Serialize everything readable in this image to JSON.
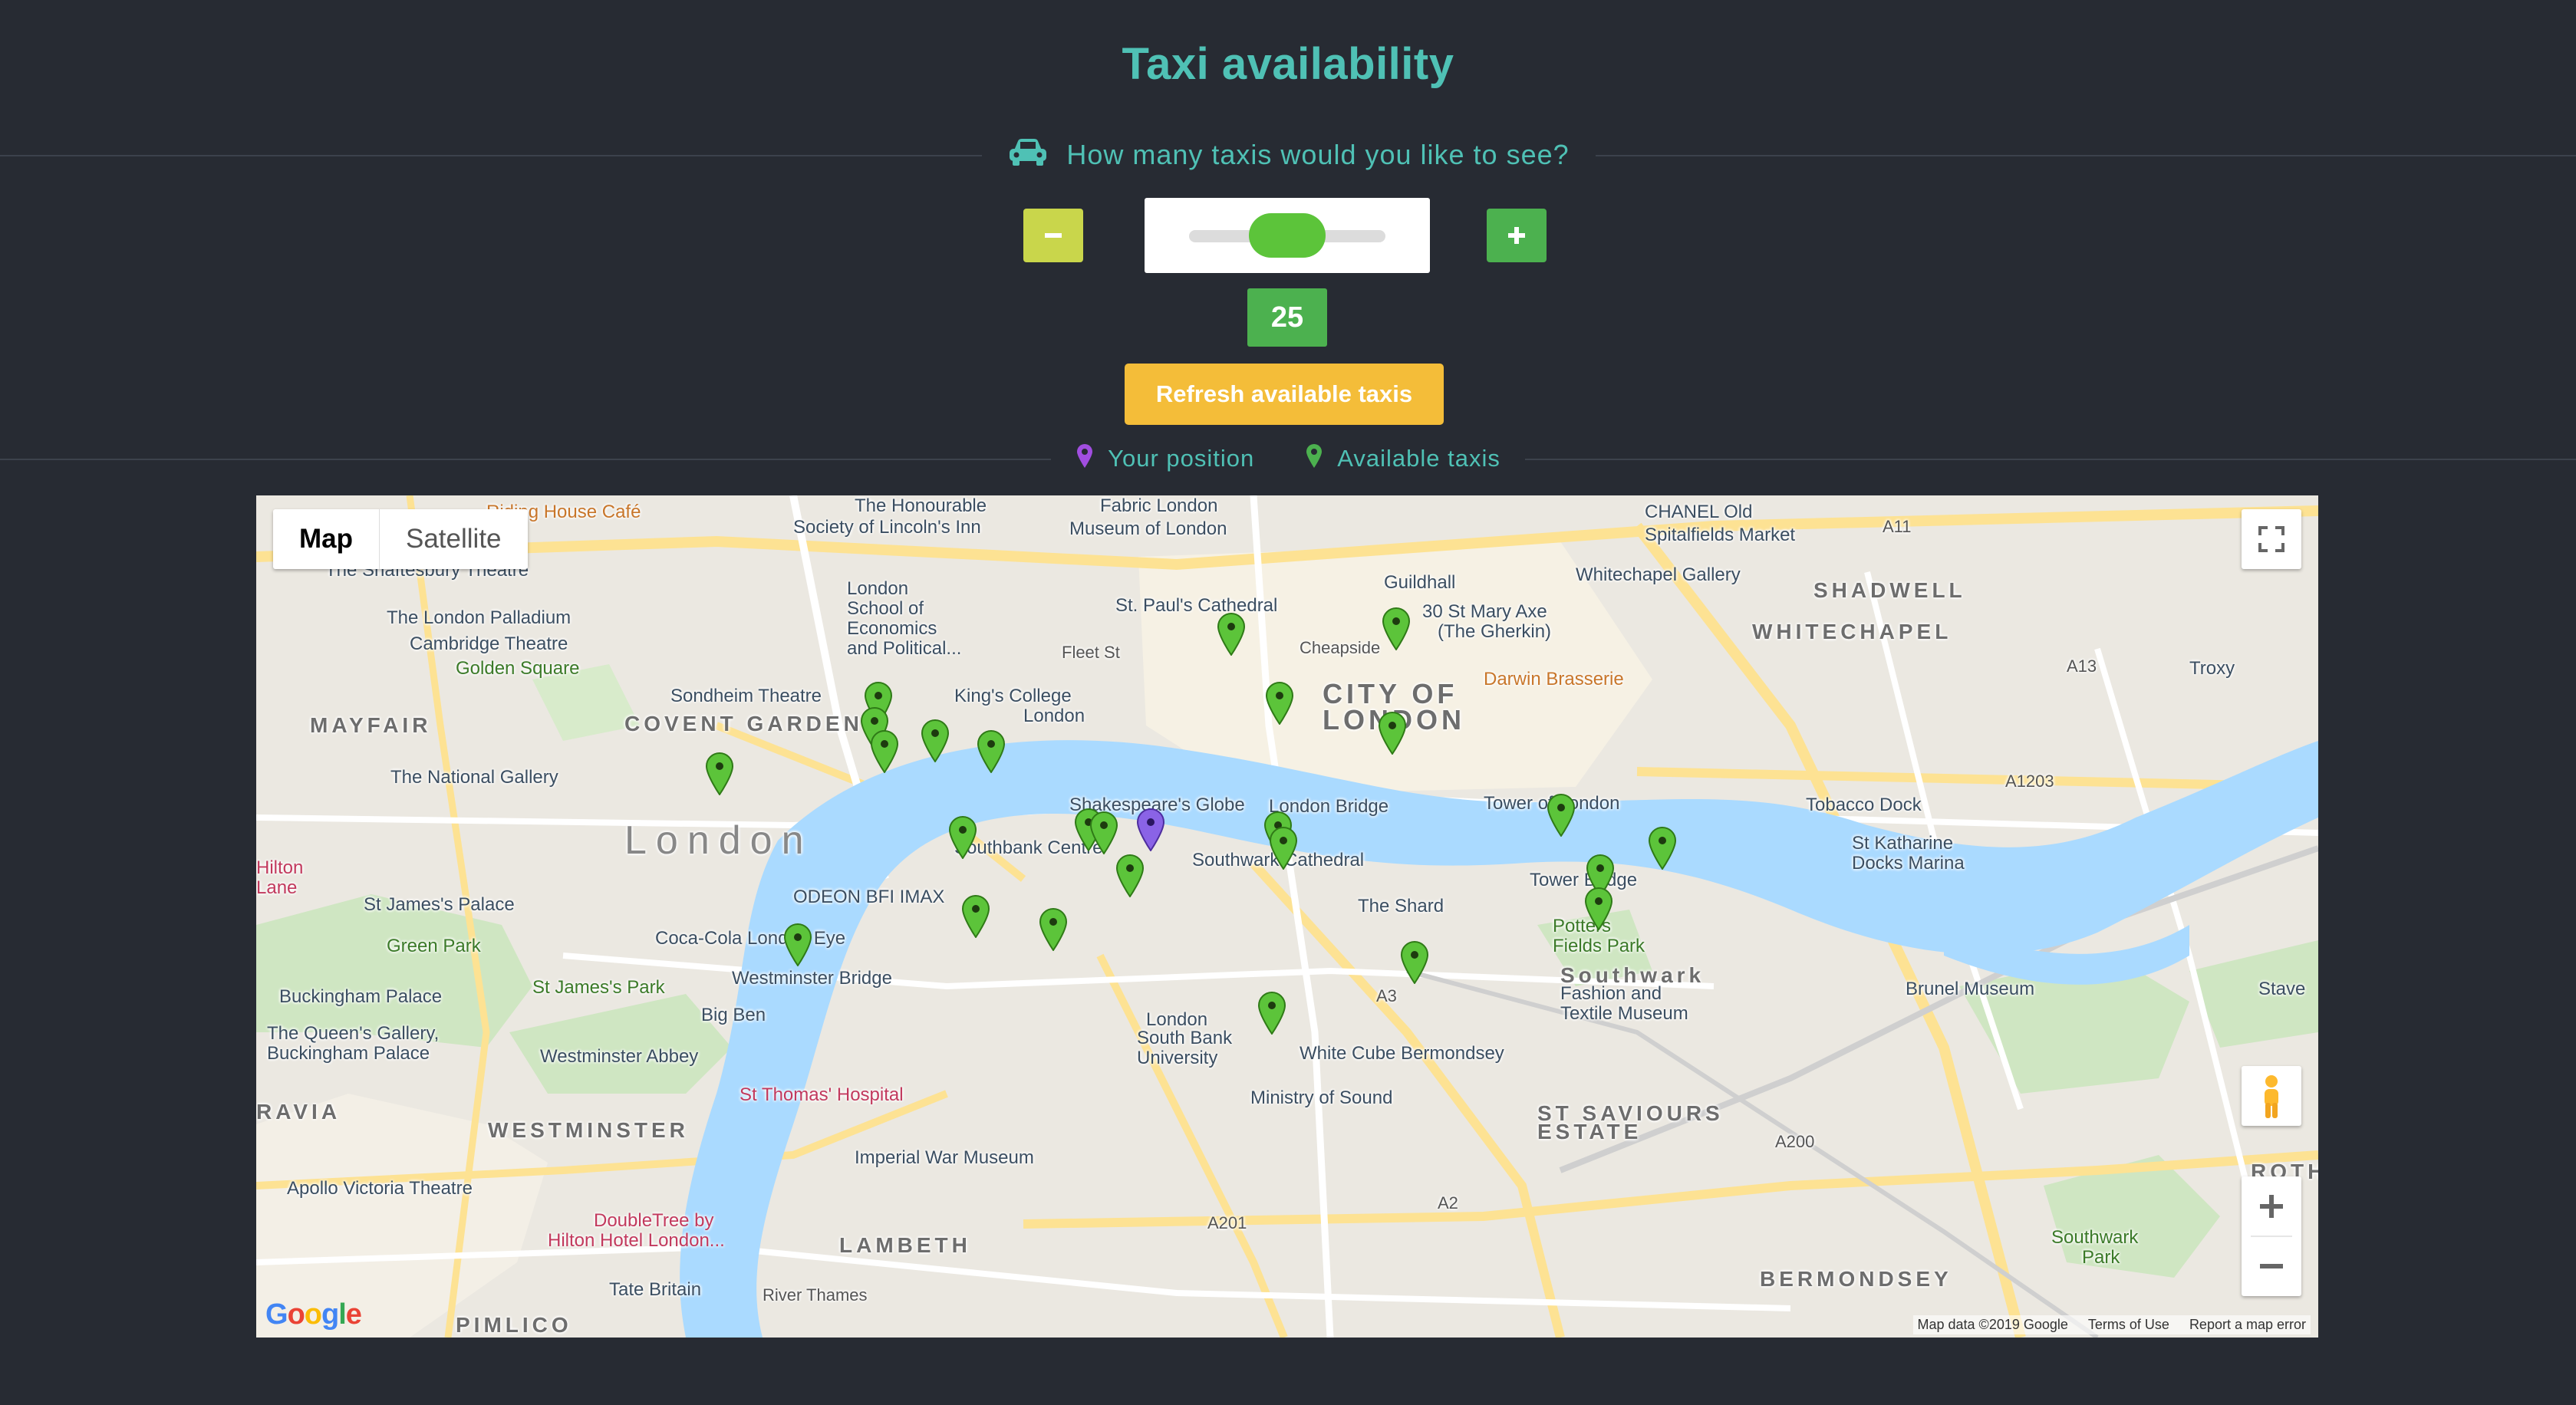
{
  "page": {
    "title": "Taxi availability",
    "question": "How many taxis would you like to see?",
    "minus_label": "−",
    "plus_label": "+",
    "taxi_count": "25",
    "slider_value": 25,
    "refresh_label": "Refresh available taxis",
    "legend_your_position": "Your position",
    "legend_available_taxis": "Available taxis"
  },
  "colors": {
    "accent": "#4fc1b5",
    "background": "#272b33",
    "minus_button": "#c9d64b",
    "plus_button": "#4cb14f",
    "refresh_button": "#f4bd39",
    "taxi_pin": "#5cc43a",
    "position_pin": "#8a63e6"
  },
  "map": {
    "type_tabs": [
      "Map",
      "Satellite"
    ],
    "active_tab": "Map",
    "attribution": [
      "Map data ©2019 Google",
      "Terms of Use",
      "Report a map error"
    ],
    "google_logo": "Google",
    "labels": [
      {
        "text": "Riding House Café",
        "cls": "place food"
      },
      {
        "text": "The Honourable",
        "cls": "place"
      },
      {
        "text": "Society of Lincoln's Inn",
        "cls": "place"
      },
      {
        "text": "Fabric London",
        "cls": "place"
      },
      {
        "text": "Museum of London",
        "cls": "place"
      },
      {
        "text": "CHANEL Old",
        "cls": "place"
      },
      {
        "text": "Spitalfields Market",
        "cls": "place"
      },
      {
        "text": "The Shaftesbury Theatre",
        "cls": "place"
      },
      {
        "text": "London",
        "cls": "place"
      },
      {
        "text": "School of",
        "cls": "place"
      },
      {
        "text": "Economics",
        "cls": "place"
      },
      {
        "text": "and Political...",
        "cls": "place"
      },
      {
        "text": "Guildhall",
        "cls": "place"
      },
      {
        "text": "Whitechapel Gallery",
        "cls": "place"
      },
      {
        "text": "SHADWELL",
        "cls": "district"
      },
      {
        "text": "The London Palladium",
        "cls": "place"
      },
      {
        "text": "Cambridge Theatre",
        "cls": "place"
      },
      {
        "text": "St. Paul's Cathedral",
        "cls": "place"
      },
      {
        "text": "30 St Mary Axe",
        "cls": "place"
      },
      {
        "text": "(The Gherkin)",
        "cls": "place"
      },
      {
        "text": "WHITECHAPEL",
        "cls": "district"
      },
      {
        "text": "Golden Square",
        "cls": "place green"
      },
      {
        "text": "Fleet St",
        "cls": "road"
      },
      {
        "text": "Cheapside",
        "cls": "road"
      },
      {
        "text": "Troxy",
        "cls": "place"
      },
      {
        "text": "Sondheim Theatre",
        "cls": "place"
      },
      {
        "text": "King's College",
        "cls": "place"
      },
      {
        "text": "London",
        "cls": "place"
      },
      {
        "text": "CITY OF",
        "cls": "city"
      },
      {
        "text": "LONDON",
        "cls": "city"
      },
      {
        "text": "Darwin Brasserie",
        "cls": "place food"
      },
      {
        "text": "MAYFAIR",
        "cls": "district"
      },
      {
        "text": "COVENT GARDEN",
        "cls": "district"
      },
      {
        "text": "The National Gallery",
        "cls": "place"
      },
      {
        "text": "Shakespeare's Globe",
        "cls": "place"
      },
      {
        "text": "London Bridge",
        "cls": "place"
      },
      {
        "text": "Tower of London",
        "cls": "place"
      },
      {
        "text": "Tobacco Dock",
        "cls": "place"
      },
      {
        "text": "London",
        "cls": "big"
      },
      {
        "text": "Southbank Centre",
        "cls": "place"
      },
      {
        "text": "Southwark Cathedral",
        "cls": "place"
      },
      {
        "text": "St Katharine",
        "cls": "place"
      },
      {
        "text": "Docks Marina",
        "cls": "place"
      },
      {
        "text": "Tower Bridge",
        "cls": "place"
      },
      {
        "text": "ODEON BFI IMAX",
        "cls": "place"
      },
      {
        "text": "The Shard",
        "cls": "place"
      },
      {
        "text": "Hilton",
        "cls": "place pink"
      },
      {
        "text": "Lane",
        "cls": "place pink"
      },
      {
        "text": "St James's Palace",
        "cls": "place"
      },
      {
        "text": "Potters",
        "cls": "place green"
      },
      {
        "text": "Fields Park",
        "cls": "place green"
      },
      {
        "text": "Coca-Cola London Eye",
        "cls": "place"
      },
      {
        "text": "Green Park",
        "cls": "place green"
      },
      {
        "text": "Brunel Museum",
        "cls": "place"
      },
      {
        "text": "Southwark",
        "cls": "district"
      },
      {
        "text": "Buckingham Palace",
        "cls": "place"
      },
      {
        "text": "St James's Park",
        "cls": "place green"
      },
      {
        "text": "Westminster Bridge",
        "cls": "place"
      },
      {
        "text": "Fashion and",
        "cls": "place"
      },
      {
        "text": "Textile Museum",
        "cls": "place"
      },
      {
        "text": "Stave",
        "cls": "place"
      },
      {
        "text": "Big Ben",
        "cls": "place"
      },
      {
        "text": "The Queen's Gallery,",
        "cls": "place"
      },
      {
        "text": "Buckingham Palace",
        "cls": "place"
      },
      {
        "text": "London",
        "cls": "place"
      },
      {
        "text": "South Bank",
        "cls": "place"
      },
      {
        "text": "University",
        "cls": "place"
      },
      {
        "text": "White Cube Bermondsey",
        "cls": "place"
      },
      {
        "text": "Westminster Abbey",
        "cls": "place"
      },
      {
        "text": "St Thomas' Hospital",
        "cls": "place pink"
      },
      {
        "text": "Ministry of Sound",
        "cls": "place"
      },
      {
        "text": "RAVIA",
        "cls": "district"
      },
      {
        "text": "WESTMINSTER",
        "cls": "district"
      },
      {
        "text": "ST SAVIOURS",
        "cls": "district"
      },
      {
        "text": "ESTATE",
        "cls": "district"
      },
      {
        "text": "ROTHERH",
        "cls": "district"
      },
      {
        "text": "Imperial War Museum",
        "cls": "place"
      },
      {
        "text": "Apollo Victoria Theatre",
        "cls": "place"
      },
      {
        "text": "DoubleTree by",
        "cls": "place pink"
      },
      {
        "text": "Hilton Hotel London...",
        "cls": "place pink"
      },
      {
        "text": "LAMBETH",
        "cls": "district"
      },
      {
        "text": "Southwark",
        "cls": "place green"
      },
      {
        "text": "Park",
        "cls": "place green"
      },
      {
        "text": "BERMONDSEY",
        "cls": "district"
      },
      {
        "text": "Tate Britain",
        "cls": "place"
      },
      {
        "text": "PIMLICO",
        "cls": "district"
      },
      {
        "text": "River Thames",
        "cls": "road"
      },
      {
        "text": "A1203",
        "cls": "road"
      },
      {
        "text": "A13",
        "cls": "road"
      },
      {
        "text": "A11",
        "cls": "road"
      },
      {
        "text": "A201",
        "cls": "road"
      },
      {
        "text": "A200",
        "cls": "road"
      },
      {
        "text": "A3",
        "cls": "road"
      },
      {
        "text": "A2",
        "cls": "road"
      }
    ],
    "taxis": [
      {
        "lat": 51.5136,
        "lng": -0.118
      },
      {
        "lat": 51.5126,
        "lng": -0.1182
      },
      {
        "lat": 51.5117,
        "lng": -0.1177
      },
      {
        "lat": 51.5121,
        "lng": -0.115
      },
      {
        "lat": 51.5117,
        "lng": -0.112
      },
      {
        "lat": 51.5108,
        "lng": -0.1265
      },
      {
        "lat": 51.5083,
        "lng": -0.1135
      },
      {
        "lat": 51.5086,
        "lng": -0.1068
      },
      {
        "lat": 51.5085,
        "lng": -0.106
      },
      {
        "lat": 51.5068,
        "lng": -0.1046
      },
      {
        "lat": 51.5052,
        "lng": -0.1128
      },
      {
        "lat": 51.5047,
        "lng": -0.1087
      },
      {
        "lat": 51.5041,
        "lng": -0.1223
      },
      {
        "lat": 51.5163,
        "lng": -0.0992
      },
      {
        "lat": 51.5165,
        "lng": -0.0904
      },
      {
        "lat": 51.5136,
        "lng": -0.0966
      },
      {
        "lat": 51.5124,
        "lng": -0.0906
      },
      {
        "lat": 51.5085,
        "lng": -0.0967
      },
      {
        "lat": 51.5079,
        "lng": -0.0964
      },
      {
        "lat": 51.5092,
        "lng": -0.0816
      },
      {
        "lat": 51.5079,
        "lng": -0.0762
      },
      {
        "lat": 51.5068,
        "lng": -0.0795
      },
      {
        "lat": 51.5055,
        "lng": -0.0796
      },
      {
        "lat": 51.5034,
        "lng": -0.0894
      },
      {
        "lat": 51.5014,
        "lng": -0.097
      }
    ],
    "your_position": {
      "lat": 51.5086,
      "lng": -0.1035
    }
  }
}
